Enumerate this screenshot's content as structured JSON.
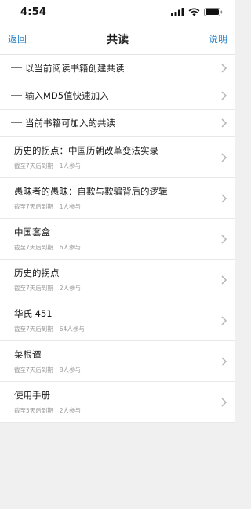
{
  "status_bar": {
    "time": "4:54",
    "icons": [
      "signal-icon",
      "wifi-icon",
      "battery-icon"
    ]
  },
  "nav": {
    "back_label": "返回",
    "title": "共读",
    "help_label": "说明"
  },
  "actions": [
    {
      "label": "以当前阅读书籍创建共读",
      "icon": "plus-icon"
    },
    {
      "label": "输入MD5值快速加入",
      "icon": "plus-icon"
    },
    {
      "label": "当前书籍可加入的共读",
      "icon": "plus-icon"
    }
  ],
  "books": [
    {
      "title": "历史的拐点：中国历朝改革变法实录",
      "deadline": "截至7天后到期",
      "participants": "1人参与"
    },
    {
      "title": "愚昧者的愚昧：自欺与欺骗背后的逻辑",
      "deadline": "截至7天后到期",
      "participants": "1人参与"
    },
    {
      "title": "中国套盒",
      "deadline": "截至7天后到期",
      "participants": "6人参与"
    },
    {
      "title": "历史的拐点",
      "deadline": "截至7天后到期",
      "participants": "2人参与"
    },
    {
      "title": "华氏 451",
      "deadline": "截至7天后到期",
      "participants": "64人参与"
    },
    {
      "title": "菜根谭",
      "deadline": "截至7天后到期",
      "participants": "8人参与"
    },
    {
      "title": "使用手册",
      "deadline": "截至5天后到期",
      "participants": "2人参与"
    }
  ],
  "colors": {
    "accent": "#2d86cc",
    "background": "#f0f0f0",
    "meta_text": "#9a9a9a"
  }
}
